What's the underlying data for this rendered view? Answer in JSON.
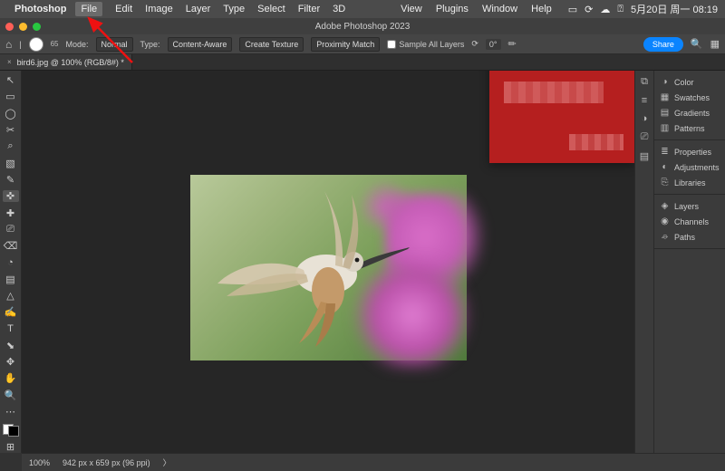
{
  "menubar": {
    "app_name": "Photoshop",
    "items": [
      "File",
      "Edit",
      "Image",
      "Layer",
      "Type",
      "Select",
      "Filter",
      "3D"
    ],
    "right_items": [
      "View",
      "Plugins",
      "Window",
      "Help"
    ],
    "highlighted_index": 0,
    "clock": "5月20日 周一  08:19"
  },
  "window": {
    "title": "Adobe Photoshop 2023"
  },
  "options_bar": {
    "brush_size": "65",
    "mode_label": "Mode:",
    "mode_value": "Normal",
    "type_label": "Type:",
    "type_buttons": [
      "Content-Aware",
      "Create Texture",
      "Proximity Match"
    ],
    "sample_all_label": "Sample All Layers",
    "angle_icon": "⟳",
    "angle_value": "0°",
    "share_label": "Share"
  },
  "document_tab": {
    "label": "bird6.jpg @ 100% (RGB/8#) *"
  },
  "tools": [
    "↖",
    "▭",
    "◯",
    "✂",
    "⌕",
    "▧",
    "✎",
    "✜",
    "✚",
    "⎚",
    "⌫",
    "◔",
    "▤",
    "△",
    "✍",
    "T",
    "⬊",
    "✥",
    "✋",
    "🔍",
    "⋯",
    "⊞"
  ],
  "dock_icons": [
    "⧉",
    "≡",
    "◑",
    "⎚",
    "▤"
  ],
  "panels": {
    "group1": [
      {
        "icon": "◑",
        "label": "Color"
      },
      {
        "icon": "▦",
        "label": "Swatches"
      },
      {
        "icon": "▤",
        "label": "Gradients"
      },
      {
        "icon": "▥",
        "label": "Patterns"
      }
    ],
    "group2": [
      {
        "icon": "≣",
        "label": "Properties"
      },
      {
        "icon": "◐",
        "label": "Adjustments"
      },
      {
        "icon": "⎘",
        "label": "Libraries"
      }
    ],
    "group3": [
      {
        "icon": "◈",
        "label": "Layers"
      },
      {
        "icon": "◉",
        "label": "Channels"
      },
      {
        "icon": "⌮",
        "label": "Paths"
      }
    ]
  },
  "status": {
    "zoom": "100%",
    "dims": "942 px x 659 px (96 ppi)"
  },
  "annotation": {
    "target": "File menu"
  }
}
